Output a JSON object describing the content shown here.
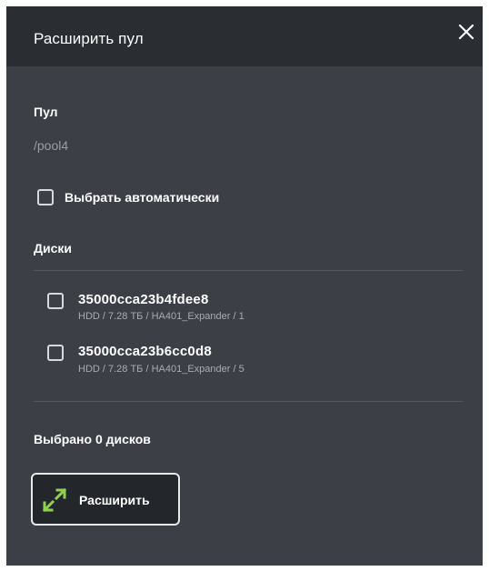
{
  "dialog": {
    "title": "Расширить пул",
    "close_icon": "close-icon"
  },
  "pool": {
    "label": "Пул",
    "value": "/pool4"
  },
  "auto_select": {
    "label": "Выбрать автоматически",
    "checked": false
  },
  "disks": {
    "label": "Диски",
    "items": [
      {
        "id": "35000cca23b4fdee8",
        "meta": "HDD / 7.28 ТБ / HA401_Expander / 1",
        "checked": false
      },
      {
        "id": "35000cca23b6cc0d8",
        "meta": "HDD / 7.28 ТБ / HA401_Expander / 5",
        "checked": false
      }
    ]
  },
  "selected_text": "Выбрано 0 дисков",
  "expand_button": {
    "label": "Расширить",
    "icon": "expand-arrows-icon",
    "icon_color": "#8fd14f"
  },
  "colors": {
    "panel": "#3c3f45",
    "header": "#2a2d32",
    "muted_text": "#9a9da3"
  }
}
